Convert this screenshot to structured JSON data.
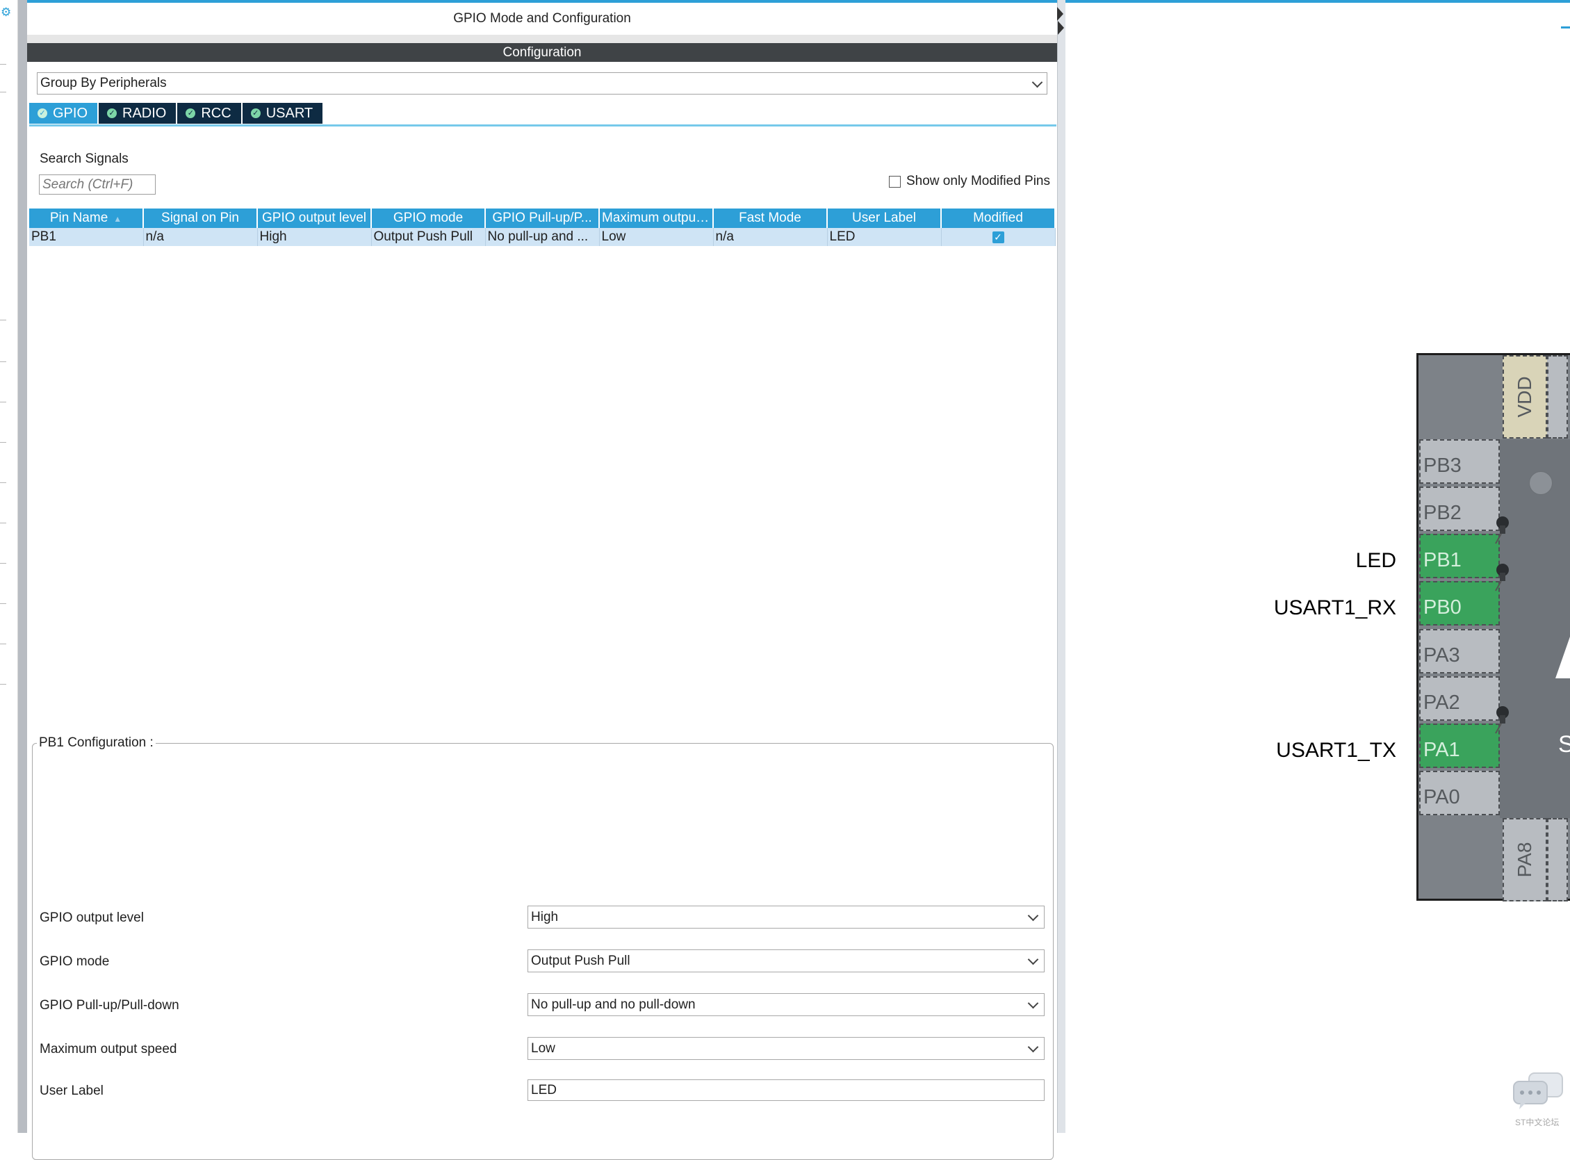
{
  "panel": {
    "title": "GPIO Mode and Configuration",
    "config_bar": "Configuration",
    "group_by": "Group By Peripherals"
  },
  "tabs": [
    {
      "label": "GPIO",
      "active": true
    },
    {
      "label": "RADIO",
      "active": false
    },
    {
      "label": "RCC",
      "active": false
    },
    {
      "label": "USART",
      "active": false
    }
  ],
  "search": {
    "label": "Search Signals",
    "placeholder": "Search (Ctrl+F)",
    "show_modified": "Show only Modified Pins",
    "show_modified_checked": false
  },
  "table": {
    "headers": [
      "Pin Name",
      "Signal on Pin",
      "GPIO output level",
      "GPIO mode",
      "GPIO Pull-up/P...",
      "Maximum output...",
      "Fast Mode",
      "User Label",
      "Modified"
    ],
    "rows": [
      [
        "PB1",
        "n/a",
        "High",
        "Output Push Pull",
        "No pull-up and ...",
        "Low",
        "n/a",
        "LED",
        "✓"
      ]
    ]
  },
  "config": {
    "legend": "PB1 Configuration :",
    "fields": [
      {
        "label": "GPIO output level",
        "value": "High"
      },
      {
        "label": "GPIO mode",
        "value": "Output Push Pull"
      },
      {
        "label": "GPIO Pull-up/Pull-down",
        "value": "No pull-up and no pull-down"
      },
      {
        "label": "Maximum output speed",
        "value": "Low"
      },
      {
        "label": "User Label",
        "value": "LED"
      }
    ]
  },
  "chip": {
    "top_pin": "VDD",
    "bottom_pin": "PA8",
    "left_pins": [
      "PB3",
      "PB2",
      "PB1",
      "PB0",
      "PA3",
      "PA2",
      "PA1",
      "PA0"
    ],
    "active_pins": [
      "PB1",
      "PB0",
      "PA1"
    ],
    "pin_labels": {
      "PB1": "LED",
      "PB0": "USART1_RX",
      "PA1": "USART1_TX"
    }
  },
  "watermark": "ST中文论坛",
  "colors": {
    "accent": "#2d9fd7",
    "tab_dark": "#0e2b43",
    "pin_green": "#3aa35c",
    "header_bar": "#3f4346"
  }
}
